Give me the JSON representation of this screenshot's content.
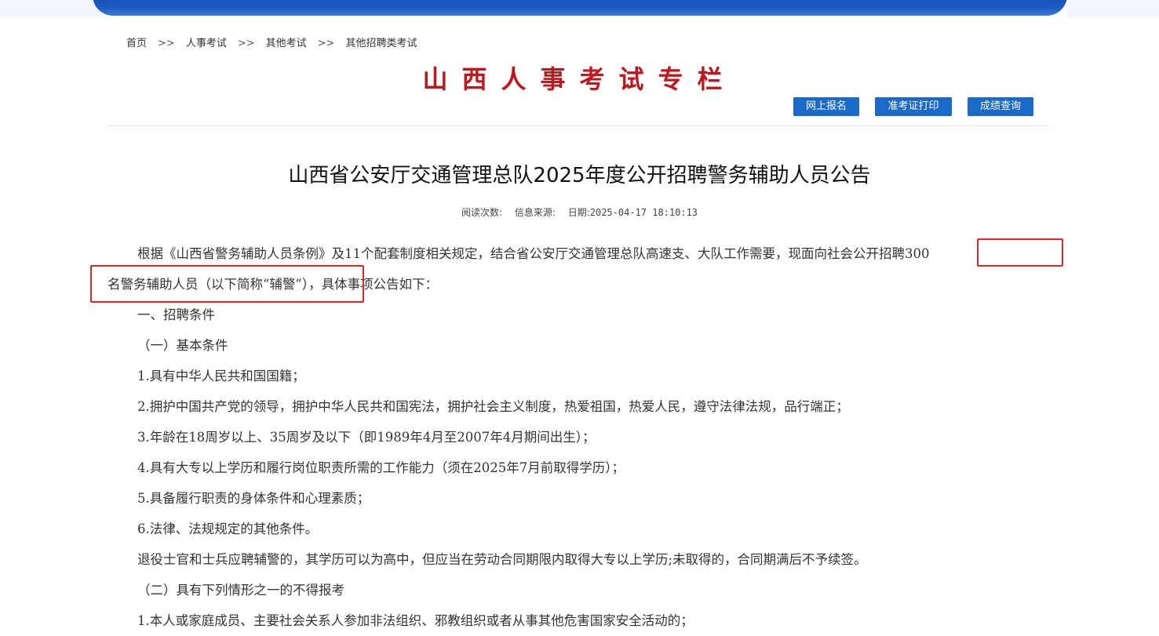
{
  "breadcrumb": {
    "items": [
      "首页",
      "人事考试",
      "其他考试",
      "其他招聘类考试"
    ],
    "separator": ">>"
  },
  "column_title": "山西人事考试专栏",
  "buttons": {
    "signup": "网上报名",
    "admit_card": "准考证打印",
    "score": "成绩查询"
  },
  "article": {
    "title": "山西省公安厅交通管理总队2025年度公开招聘警务辅助人员公告",
    "meta": {
      "reads_label": "阅读次数:",
      "source_label": "信息来源:",
      "date_label": "日期:",
      "date_value": "2025-04-17 18:10:13"
    },
    "paragraphs": [
      "根据《山西省警务辅助人员条例》及11个配套制度相关规定，结合省公安厅交通管理总队高速支、大队工作需要，现面向社会公开招聘300",
      "名警务辅助人员（以下简称“辅警”），具体事项公告如下：",
      "一、招聘条件",
      "（一）基本条件",
      "1.具有中华人民共和国国籍；",
      "2.拥护中国共产党的领导，拥护中华人民共和国宪法，拥护社会主义制度，热爱祖国，热爱人民，遵守法律法规，品行端正；",
      "3.年龄在18周岁以上、35周岁及以下（即1989年4月至2007年4月期间出生）；",
      "4.具有大专以上学历和履行岗位职责所需的工作能力（须在2025年7月前取得学历）；",
      "5.具备履行职责的身体条件和心理素质；",
      "6.法律、法规规定的其他条件。",
      "退役士官和士兵应聘辅警的，其学历可以为高中，但应当在劳动合同期限内取得大专以上学历;未取得的，合同期满后不予续签。",
      "（二）具有下列情形之一的不得报考",
      "1.本人或家庭成员、主要社会关系人参加非法组织、邪教组织或者从事其他危害国家安全活动的；"
    ]
  },
  "colors": {
    "title_red": "#c0171e",
    "button_blue": "#1b6ac9",
    "highlight_red": "#e0262b"
  }
}
